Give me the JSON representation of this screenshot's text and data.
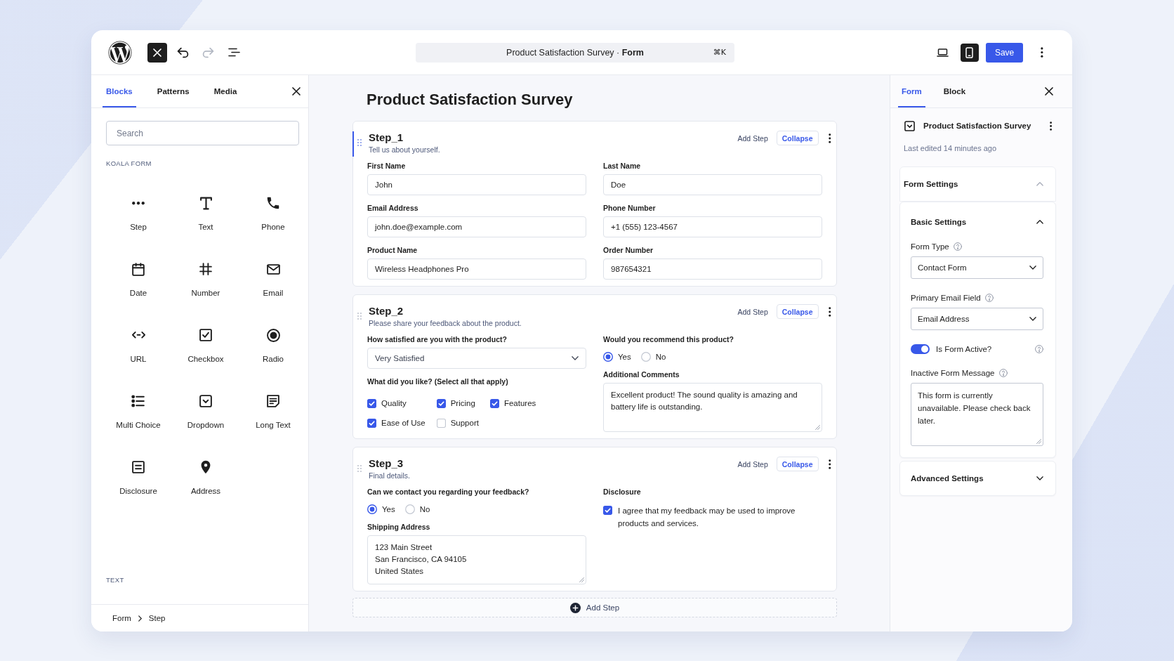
{
  "toolbar": {
    "inserter_toggle": {
      "active": true
    },
    "history": [
      {
        "kind": "undo",
        "disabled": false
      },
      {
        "kind": "redo",
        "disabled": true
      }
    ],
    "command_bar": {
      "title": "Product Satisfaction Survey · **Form**",
      "shortcut": "⌘K"
    },
    "preview_modes": [
      {
        "kind": "desktop",
        "selected": false
      },
      {
        "kind": "mobile",
        "selected": true
      }
    ],
    "save_label": "Save"
  },
  "inserter": {
    "tabs": [
      {
        "label": "Blocks",
        "selected": true
      },
      {
        "label": "Patterns",
        "selected": false
      },
      {
        "label": "Media",
        "selected": false
      }
    ],
    "search": {
      "placeholder": "Search"
    },
    "sections": [
      {
        "heading": "KOALA FORM",
        "blocks": [
          {
            "kind": "step",
            "label": "Step"
          },
          {
            "kind": "text",
            "label": "Text"
          },
          {
            "kind": "phone",
            "label": "Phone"
          },
          {
            "kind": "date",
            "label": "Date"
          },
          {
            "kind": "number",
            "label": "Number"
          },
          {
            "kind": "email",
            "label": "Email"
          },
          {
            "kind": "url",
            "label": "URL"
          },
          {
            "kind": "checkbox",
            "label": "Checkbox"
          },
          {
            "kind": "radio",
            "label": "Radio"
          },
          {
            "kind": "multichoice",
            "label": "Multi Choice"
          },
          {
            "kind": "dropdown",
            "label": "Dropdown"
          },
          {
            "kind": "longtext",
            "label": "Long Text"
          },
          {
            "kind": "disclosure",
            "label": "Disclosure"
          },
          {
            "kind": "address",
            "label": "Address"
          }
        ]
      },
      {
        "heading": "TEXT"
      }
    ],
    "breadcrumb": [
      "Form",
      "Step"
    ]
  },
  "canvas": {
    "title": "Product Satisfaction Survey",
    "steps": [
      {
        "title": "Step_1",
        "description": "Tell us about yourself.",
        "selected": true,
        "add_step_label": "Add Step",
        "collapse_label": "Collapse",
        "columns": [
          {
            "fields": [
              {
                "kind": "text",
                "label": "First Name",
                "value": "John"
              },
              {
                "kind": "text",
                "label": "Email Address",
                "value": "john.doe@example.com"
              },
              {
                "kind": "text",
                "label": "Product Name",
                "value": "Wireless Headphones Pro"
              }
            ]
          },
          {
            "fields": [
              {
                "kind": "text",
                "label": "Last Name",
                "value": "Doe"
              },
              {
                "kind": "text",
                "label": "Phone Number",
                "value": "+1 (555) 123-4567"
              },
              {
                "kind": "text",
                "label": "Order Number",
                "value": "987654321"
              }
            ]
          }
        ]
      },
      {
        "title": "Step_2",
        "description": "Please share your feedback about the product.",
        "selected": false,
        "add_step_label": "Add Step",
        "collapse_label": "Collapse",
        "columns": [
          {
            "fields": [
              {
                "kind": "select",
                "label": "How satisfied are you with the product?",
                "value": "Very Satisfied"
              },
              {
                "kind": "checkboxes",
                "label": "What did you like? (Select all that apply)",
                "options": [
                  {
                    "label": "Quality",
                    "checked": true
                  },
                  {
                    "label": "Pricing",
                    "checked": true
                  },
                  {
                    "label": "Features",
                    "checked": true
                  },
                  {
                    "label": "Ease of Use",
                    "checked": true
                  },
                  {
                    "label": "Support",
                    "checked": false
                  }
                ]
              }
            ]
          },
          {
            "fields": [
              {
                "kind": "radio",
                "label": "Would you recommend this product?",
                "options": [
                  {
                    "label": "Yes",
                    "selected": true
                  },
                  {
                    "label": "No",
                    "selected": false
                  }
                ]
              },
              {
                "kind": "textarea",
                "label": "Additional Comments",
                "value": "Excellent product! The sound quality is amazing and battery life is outstanding."
              }
            ]
          }
        ]
      },
      {
        "title": "Step_3",
        "description": "Final details.",
        "selected": false,
        "add_step_label": "Add Step",
        "collapse_label": "Collapse",
        "columns": [
          {
            "fields": [
              {
                "kind": "radio",
                "label": "Can we contact you regarding your feedback?",
                "options": [
                  {
                    "label": "Yes",
                    "selected": true
                  },
                  {
                    "label": "No",
                    "selected": false
                  }
                ]
              },
              {
                "kind": "textarea",
                "label": "Shipping Address",
                "value": "123 Main Street\nSan Francisco, CA 94105\nUnited States"
              }
            ]
          },
          {
            "fields": [
              {
                "kind": "disclosure",
                "label": "Disclosure",
                "text": "I agree that my feedback may be used to improve products and services.",
                "checked": true
              }
            ]
          }
        ]
      }
    ],
    "add_step_label": "Add Step"
  },
  "settings": {
    "tabs": [
      {
        "label": "Form",
        "selected": true
      },
      {
        "label": "Block",
        "selected": false
      }
    ],
    "form_title": "Product Satisfaction Survey",
    "last_edited": "Last edited 14 minutes ago",
    "panel": {
      "title": "Form Settings",
      "expanded": true,
      "groups": [
        {
          "title": "Basic Settings",
          "expanded": true,
          "controls": [
            {
              "kind": "select",
              "label": "Form Type",
              "value": "Contact Form"
            },
            {
              "kind": "select",
              "label": "Primary Email Field",
              "value": "Email Address"
            },
            {
              "kind": "toggle",
              "label": "Is Form Active?",
              "on": true
            },
            {
              "kind": "textarea",
              "label": "Inactive Form Message",
              "value": "This form is currently unavailable. Please check back later."
            }
          ]
        },
        {
          "title": "Advanced Settings",
          "expanded": false
        }
      ]
    }
  }
}
